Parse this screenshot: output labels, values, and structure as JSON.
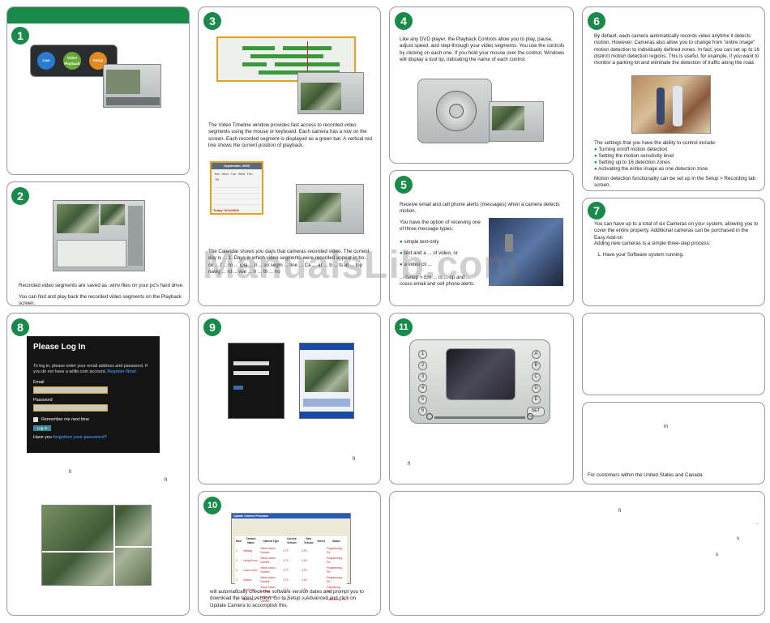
{
  "steps": {
    "s1": "1",
    "s2": "2",
    "s3": "3",
    "s4": "4",
    "s5": "5",
    "s6": "6",
    "s7": "7",
    "s8": "8",
    "s9": "9",
    "s10": "10",
    "s11": "11"
  },
  "panel2": {
    "p1": "Recorded video segments are saved as .wmv files on your pc's hard drive.",
    "p2": "You can find and play back the recorded video segments on the Playback screen."
  },
  "panel3": {
    "p1": "The Video Timeline window provides fast access to recorded video segments using the mouse or keyboard. Each camera has a row on the screen. Each recorded segment is displayed as a green bar. A vertical red line shows the current position of playback.",
    "calendar_month": "September, 2005",
    "calendar_today": "Today: 9/14/2005",
    "calendar_days": [
      "Sun",
      "Mon",
      "Tue",
      "Wed",
      "Thu",
      "Fri",
      "Sat"
    ],
    "p2": "The Calendar shows you days that cameras recorded video. The current day is ... 1. Days in which video segments were recorded appear in bo... ck ... f ... to ... ipla ... li ... so segm ... line ... Ca ... ar ... b ... ts at ... top navig ... rd ... war ... h ... th ... no"
  },
  "panel4": {
    "p1": "Like any DVD player, the Playback Controls allow you to play, pause, adjust speed, and step-through your video segments. You use the controls by clicking on each one. If you hold your mouse over the control, Windows will display a tool tip, indicating the name of each control."
  },
  "panel5": {
    "p1": "Receive email and cell phone alerts (messages) when a camera detects motion.",
    "p2": "You have the option of receiving one of three message types:",
    "b1": "simple text-only",
    "b2": "text and a ... of video, or",
    "b3": "a video cli ...",
    "p3": "... Setup > Em ... ts ... up and ... ccess email and cell phone alerts."
  },
  "panel6": {
    "p1": "By default, each camera automatically records video anytime it detects motion. However, Cameras also allow you to change from \"entire image\" motion detection to individually defined zones. In fact, you can set up to 16 distinct motion detection regions. This is useful, for example, if you want to monitor a parking lot and eliminate the detection of traffic along the road.",
    "p2": "The settings that you have the ability to control include:",
    "bullets": [
      "Turning on/off motion detection",
      "Setting the motion sensitivity level",
      "Setting up to 16 detection zones",
      "Activating the entire image as one detection zone"
    ],
    "p3": "Motion detection functionality can be set up in the Setup > Recording tab screen."
  },
  "panel7": {
    "p1": "You can have up to a total of six Cameras on your system, allowing you to cover the entire property. Additional cameras can be purchased in the Easy Add-on",
    "p2": "Adding new cameras is a simple three-step process:",
    "item1": "1. Have your Software system running."
  },
  "panel8": {
    "title": "Please Log In",
    "intro": "To log in, please enter your email address and password. If you do not have a willfe.com account,",
    "register": "Register Now!",
    "email_label": "Email",
    "password_label": "Password",
    "remember": "Remember me next time",
    "login_button": "Log In",
    "forgot_prefix": "Have you",
    "forgot_link": "forgotten your password?",
    "stray1": "fi",
    "stray2": "fi"
  },
  "panel9": {
    "stray": "fi"
  },
  "panel10": {
    "dialog_title": "Update Camera Firmware",
    "columns": [
      "Num",
      "Camera Name",
      "Camera Type",
      "Current Version",
      "New Version",
      "Select",
      "Status"
    ],
    "rows": [
      [
        "1",
        "Hallway",
        "Yellow Indoor Camera",
        "27.F",
        "2.93",
        "",
        "Programming, 2%"
      ],
      [
        "2",
        "Living Room",
        "Yellow Indoor Camera",
        "27.F",
        "2.93",
        "",
        "Programming, 2%"
      ],
      [
        "3",
        "Lower Level",
        "Yellow Indoor Camera",
        "27.F",
        "2.93",
        "",
        "Programming, 2%"
      ],
      [
        "4",
        "Kitchen",
        "Yellow Indoor Camera",
        "27.F",
        "2.93",
        "",
        "Programming, 2%"
      ],
      [
        "5",
        "Front Door",
        "Yellow Indoor Camera",
        "27.F",
        "2.93",
        "",
        "Transferring, 98%"
      ],
      [
        "6",
        "Back Door",
        "Yellow Indoor Camera",
        "27.F",
        "2.93",
        "",
        "Transferring, 1%"
      ]
    ],
    "p1": "will automatically check the software version dates and prompt you to download the latest version. Go to Setup > Advanced and click on Update Camera to accomplish this."
  },
  "panel11": {
    "stray": "fi",
    "numbers": [
      "1",
      "2",
      "3",
      "4",
      "5",
      "6"
    ],
    "letters": [
      "A",
      "B",
      "C",
      "D",
      "E"
    ],
    "set_label": "SET"
  },
  "panel13": {
    "stray": "m",
    "footer": "For customers within the United States and Canada"
  },
  "panel14": {
    "s1": "fi",
    "s2": "-",
    "s3": "s",
    "s4": "s"
  },
  "panel1": {
    "btn1": "Live",
    "btn2": "Video Playback",
    "btn3": "Setup"
  },
  "watermark": "ManualsLib.com",
  "colors": {
    "accent_green": "#1a8a4a",
    "segment_green": "#3a9a3a",
    "orange": "#e8a020",
    "link_blue": "#3a8ad8"
  }
}
